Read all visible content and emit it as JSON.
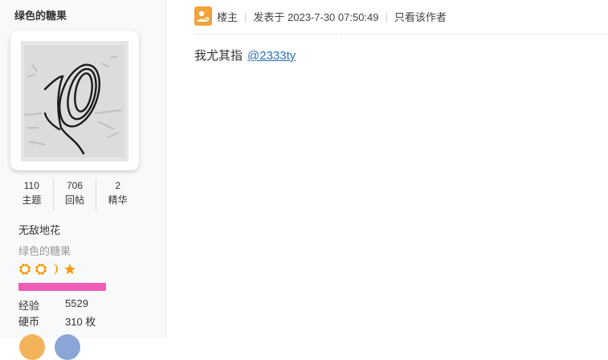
{
  "profile": {
    "username": "绿色的糖果",
    "stats": [
      {
        "value": "110",
        "label": "主题"
      },
      {
        "value": "706",
        "label": "回帖"
      },
      {
        "value": "2",
        "label": "精华"
      }
    ],
    "user_title": "无敌地花",
    "group_name": "绿色的糖果",
    "rank_icons": [
      "sun-icon",
      "sun-icon",
      "moon-icon",
      "star-icon"
    ],
    "bar_color": "#f15bb5",
    "bar_fill_fraction": 1.0,
    "experience_label": "经验",
    "experience_value": "5529",
    "coins_label": "硬币",
    "coins_value": "310 枚"
  },
  "post": {
    "op_label": "楼主",
    "posted_text": "发表于 2023-7-30 07:50:49",
    "author_only_label": "只看该作者",
    "content_text": "我尤其指",
    "mention_text": "@2333ty",
    "mention_color": "#2a6ebb",
    "badge_color": "#f0a33a"
  }
}
